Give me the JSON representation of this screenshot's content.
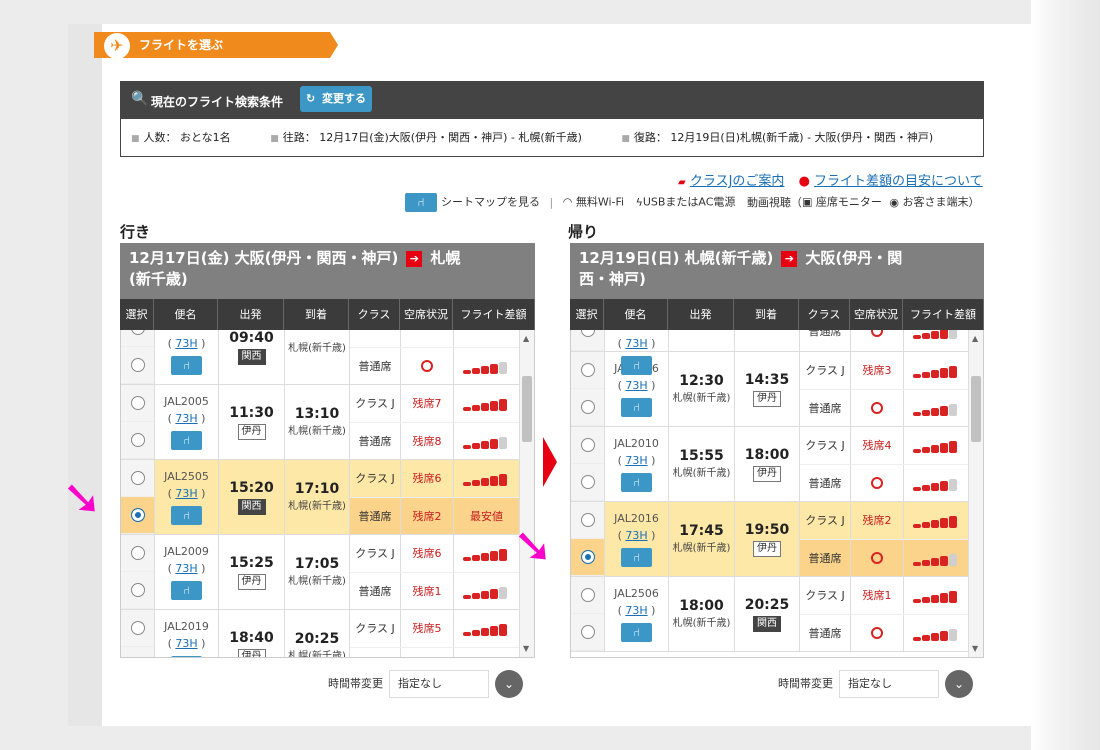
{
  "header": {
    "banner": "フライトを選ぶ"
  },
  "search": {
    "title": "現在のフライト検索条件",
    "change_button": "変更する",
    "passengers": "人数： おとな1名",
    "outbound": "往路： 12月17日(金)大阪(伊丹・関西・神戸) - 札幌(新千歳)",
    "return": "復路： 12月19日(日)札幌(新千歳) - 大阪(伊丹・関西・神戸)"
  },
  "links": {
    "classj": "クラスJのご案内",
    "fare_diff": "フライト差額の目安について"
  },
  "amenities": {
    "seatmap": "シートマップを見る",
    "wifi": "無料Wi-Fi",
    "power": "USBまたはAC電源",
    "video": "動画視聴（",
    "monitor": "座席モニター",
    "own": "お客さま端末）"
  },
  "columns": [
    "選択",
    "便名",
    "出発",
    "到着",
    "クラス",
    "空席状況",
    "フライト差額"
  ],
  "outbound_panel": {
    "direction": "行き",
    "header_line1": "12月17日(金)  大阪(伊丹・関西・神戸)",
    "header_dest": "札幌",
    "header_line2": "(新千歳)",
    "flights": [
      {
        "no": "",
        "code": "73H",
        "dep": "09:40",
        "dep_apt": "関西",
        "arr": "",
        "arr_sub": "札幌(新千歳)",
        "rows": [
          {
            "cls": "",
            "vac": ""
          },
          {
            "cls": "普通席",
            "vac": "○"
          }
        ]
      },
      {
        "no": "JAL2005",
        "code": "73H",
        "dep": "11:30",
        "dep_apt": "伊丹",
        "arr": "13:10",
        "arr_sub": "札幌(新千歳)",
        "rows": [
          {
            "cls": "クラス J",
            "vac": "残席7"
          },
          {
            "cls": "普通席",
            "vac": "残席8"
          }
        ]
      },
      {
        "no": "JAL2505",
        "code": "73H",
        "dep": "15:20",
        "dep_apt": "関西",
        "arr": "17:10",
        "arr_sub": "札幌(新千歳)",
        "rows": [
          {
            "cls": "クラス J",
            "vac": "残席6"
          },
          {
            "cls": "普通席",
            "vac": "残席2",
            "diff": "最安値"
          }
        ]
      },
      {
        "no": "JAL2009",
        "code": "73H",
        "dep": "15:25",
        "dep_apt": "伊丹",
        "arr": "17:05",
        "arr_sub": "札幌(新千歳)",
        "rows": [
          {
            "cls": "クラス J",
            "vac": "残席6"
          },
          {
            "cls": "普通席",
            "vac": "残席1"
          }
        ]
      },
      {
        "no": "JAL2019",
        "code": "73H",
        "dep": "18:40",
        "dep_apt": "伊丹",
        "arr": "20:25",
        "arr_sub": "札幌(新千歳)",
        "rows": [
          {
            "cls": "クラス J",
            "vac": "残席5"
          },
          {
            "cls": "",
            "vac": ""
          }
        ]
      }
    ]
  },
  "return_panel": {
    "direction": "帰り",
    "header_line1": "12月19日(日)  札幌(新千歳)",
    "header_dest": "大阪(伊丹・関",
    "header_line2": "西・神戸)",
    "flights": [
      {
        "no": "",
        "code": "73H",
        "dep": "",
        "dep_sub": "",
        "arr": "",
        "arr_apt": "",
        "rows": [
          {
            "cls": "普通席",
            "vac": "○"
          }
        ]
      },
      {
        "no": "JAL2006",
        "code": "73H",
        "dep": "12:30",
        "dep_sub": "札幌(新千歳)",
        "arr": "14:35",
        "arr_apt": "伊丹",
        "rows": [
          {
            "cls": "クラス J",
            "vac": "残席3"
          },
          {
            "cls": "普通席",
            "vac": "○"
          }
        ]
      },
      {
        "no": "JAL2010",
        "code": "73H",
        "dep": "15:55",
        "dep_sub": "札幌(新千歳)",
        "arr": "18:00",
        "arr_apt": "伊丹",
        "rows": [
          {
            "cls": "クラス J",
            "vac": "残席4"
          },
          {
            "cls": "普通席",
            "vac": "○"
          }
        ]
      },
      {
        "no": "JAL2016",
        "code": "73H",
        "dep": "17:45",
        "dep_sub": "札幌(新千歳)",
        "arr": "19:50",
        "arr_apt": "伊丹",
        "rows": [
          {
            "cls": "クラス J",
            "vac": "残席2"
          },
          {
            "cls": "普通席",
            "vac": "○"
          }
        ]
      },
      {
        "no": "JAL2506",
        "code": "73H",
        "dep": "18:00",
        "dep_sub": "札幌(新千歳)",
        "arr": "20:25",
        "arr_apt": "関西",
        "rows": [
          {
            "cls": "クラス J",
            "vac": "残席1"
          },
          {
            "cls": "普通席",
            "vac": "○"
          }
        ]
      }
    ]
  },
  "time_filter": {
    "label": "時間帯変更",
    "value": "指定なし"
  },
  "colors": {
    "orange": "#f08a1c",
    "blue": "#3d97c6",
    "red": "#e60012",
    "pink": "#ff00cc",
    "highlight": "#fde8a8"
  }
}
